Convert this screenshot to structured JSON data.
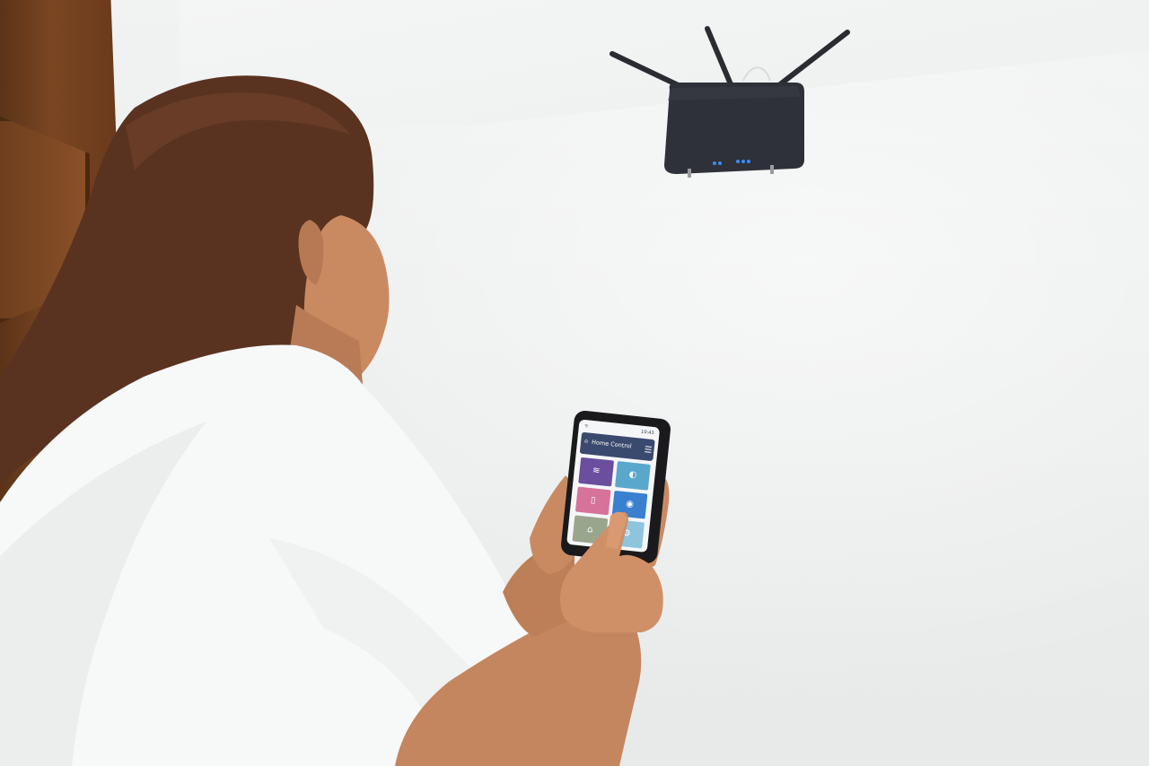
{
  "scene": {
    "photo_subject": "woman-using-smartphone-home-control-app"
  },
  "phone": {
    "status_time": "10:43",
    "status_signal": "ᯤ",
    "app_title": "Home Control",
    "tiles": [
      {
        "icon": "air-conditioner-icon",
        "color": "#6b4f9e",
        "glyph": "≋"
      },
      {
        "icon": "lightbulb-icon",
        "color": "#5aa7cc",
        "glyph": "◐"
      },
      {
        "icon": "door-icon",
        "color": "#d7739a",
        "glyph": "▯"
      },
      {
        "icon": "eye-camera-icon",
        "color": "#3a7fd0",
        "glyph": "◉"
      },
      {
        "icon": "garage-icon",
        "color": "#9aa58e",
        "glyph": "⌂"
      },
      {
        "icon": "settings-icon",
        "color": "#8ec5dd",
        "glyph": "⚙"
      }
    ]
  },
  "colors": {
    "wall": "#eceeee",
    "door": "#7a4622",
    "router": "#2c2f36",
    "router_led": "#3b8cff",
    "shirt": "#f7f8f8",
    "hair": "#5a3320",
    "skin": "#c98a62"
  }
}
